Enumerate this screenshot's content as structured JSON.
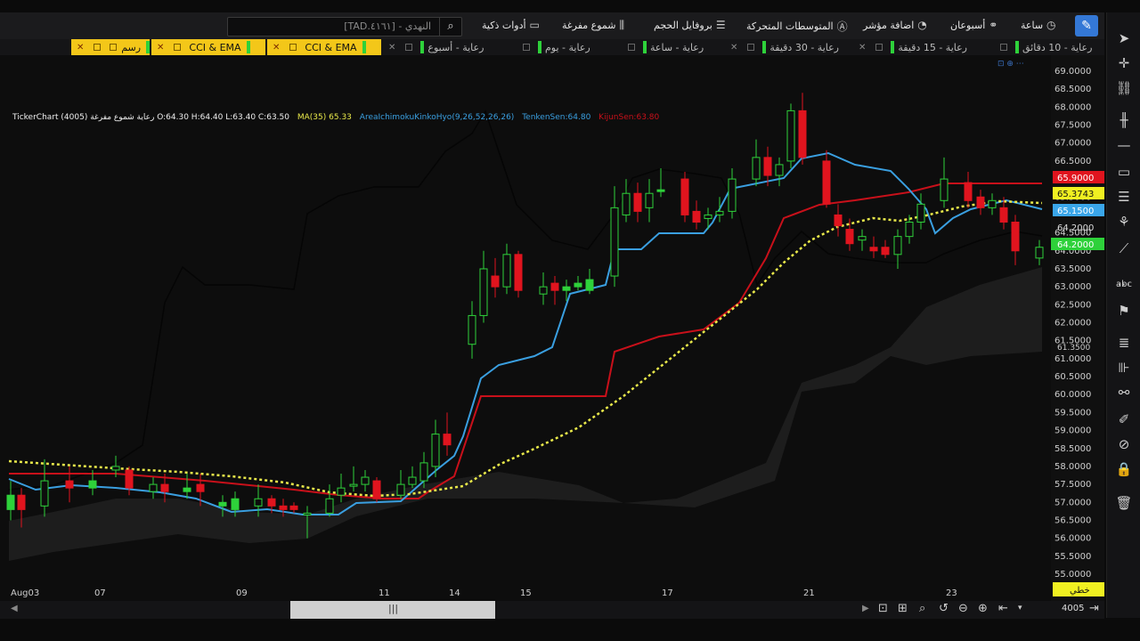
{
  "toolbar": {
    "hour": "ساعة",
    "two_weeks": "أسبوعان",
    "add_indicator": "اضافة مؤشر",
    "moving_averages": "المتوسطات المتحركة",
    "volume_profile": "بروفايل الحجم",
    "hollow_candles": "شموع مفرغة",
    "smart_tools": "أدوات ذكية",
    "search_placeholder": "[TAD.٤١٦١] - النهدي"
  },
  "tabs": [
    {
      "label": "رعاية - 10 دقائق"
    },
    {
      "label": "رعاية - 15 دقيقة"
    },
    {
      "label": "رعاية - 30 دقيقة"
    },
    {
      "label": "رعاية - ساعة"
    },
    {
      "label": "رعاية - يوم"
    },
    {
      "label": "رعاية - أسبوع"
    },
    {
      "label": "CCI & EMA"
    },
    {
      "label": "CCI & EMA"
    },
    {
      "label": "رسم"
    }
  ],
  "legend": {
    "title": "TickerChart رعاية شموع مفرغة (4005) O:64.30 H:64.40 L:63.40 C:63.50",
    "ma": "MA(35)",
    "ma_value": "65.33",
    "ichimoku": "AreaIchimokuKinkoHyo(9,26,52,26,26)",
    "tenken": "TenkenSen:64.80",
    "kijun": "KijunSen:63.80"
  },
  "y_labels": [
    "69.0000",
    "68.5000",
    "68.0000",
    "67.5000",
    "67.0000",
    "66.5000",
    "66.0000",
    "65.5000",
    "64.5000",
    "64.0000",
    "63.5000",
    "63.0000",
    "62.5000",
    "62.0000",
    "61.5000",
    "61.0000",
    "60.5000",
    "60.0000",
    "59.5000",
    "59.0000",
    "58.5000",
    "58.0000",
    "57.5000",
    "57.0000",
    "56.5000",
    "56.0000",
    "55.5000",
    "55.0000"
  ],
  "price_tags": {
    "red": "65.9000",
    "yellow": "65.3743",
    "blue": "65.1500",
    "plain": "64.2000",
    "green": "64.2000",
    "small": "61.3500"
  },
  "x_labels": [
    "Aug03",
    "07",
    "09",
    "11",
    "14",
    "15",
    "17",
    "21",
    "23"
  ],
  "line_type": "خطي",
  "bottom_count": "4005",
  "colors": {
    "up": "#2ed13a",
    "down": "#e0141e",
    "tenken": "#3a9fe0",
    "kijun": "#c8101a",
    "ma": "#e8e84a"
  }
}
